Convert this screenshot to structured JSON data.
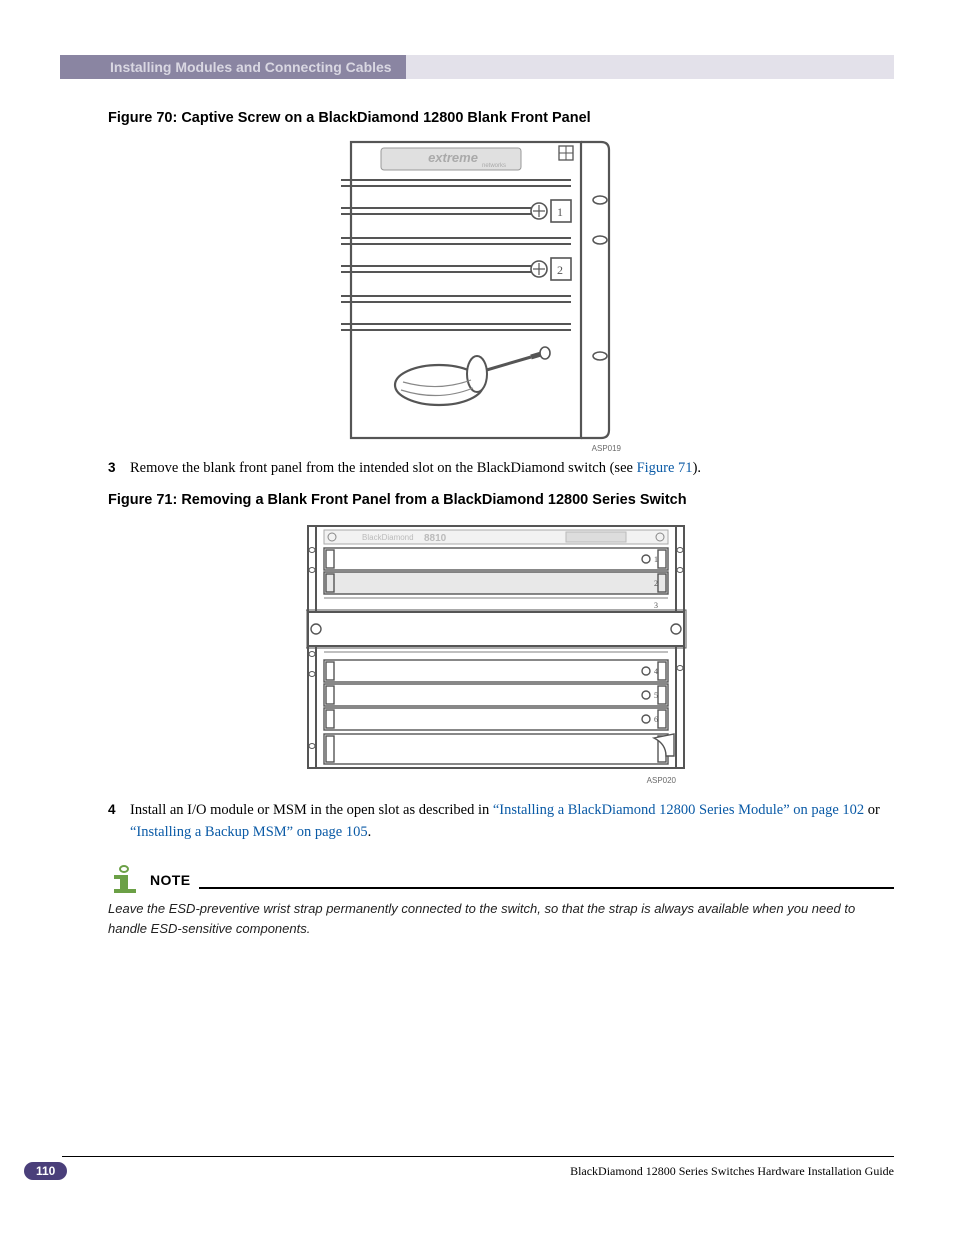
{
  "header": {
    "section_title": "Installing Modules and Connecting Cables"
  },
  "figures": {
    "fig70": {
      "caption": "Figure 70:  Captive Screw on a BlackDiamond 12800 Blank Front Panel",
      "brand_text": "extreme",
      "brand_sub": "networks",
      "slot_numbers": [
        "1",
        "2"
      ],
      "ref_id": "ASP019"
    },
    "fig71": {
      "caption": "Figure 71:  Removing a Blank Front Panel from a BlackDiamond 12800 Series Switch",
      "device_label": "BlackDiamond 8810",
      "slot_numbers": [
        "1",
        "2",
        "3",
        "4",
        "5",
        "6"
      ],
      "ref_id": "ASP020"
    }
  },
  "steps": {
    "s3": {
      "num": "3",
      "text_pre": "Remove the blank front panel from the intended slot on the BlackDiamond switch (see ",
      "link": "Figure 71",
      "text_post": ")."
    },
    "s4": {
      "num": "4",
      "text_pre": "Install an I/O module or MSM in the open slot as described in ",
      "link1": "“Installing a BlackDiamond 12800 Series Module” on page 102",
      "mid": " or ",
      "link2": "“Installing a Backup MSM” on page 105",
      "text_post": "."
    }
  },
  "note": {
    "label": "NOTE",
    "text": "Leave the ESD-preventive wrist strap permanently connected to the switch, so that the strap is always available when you need to handle ESD-sensitive components."
  },
  "footer": {
    "page_number": "110",
    "doc_title": "BlackDiamond 12800 Series Switches Hardware Installation Guide"
  }
}
